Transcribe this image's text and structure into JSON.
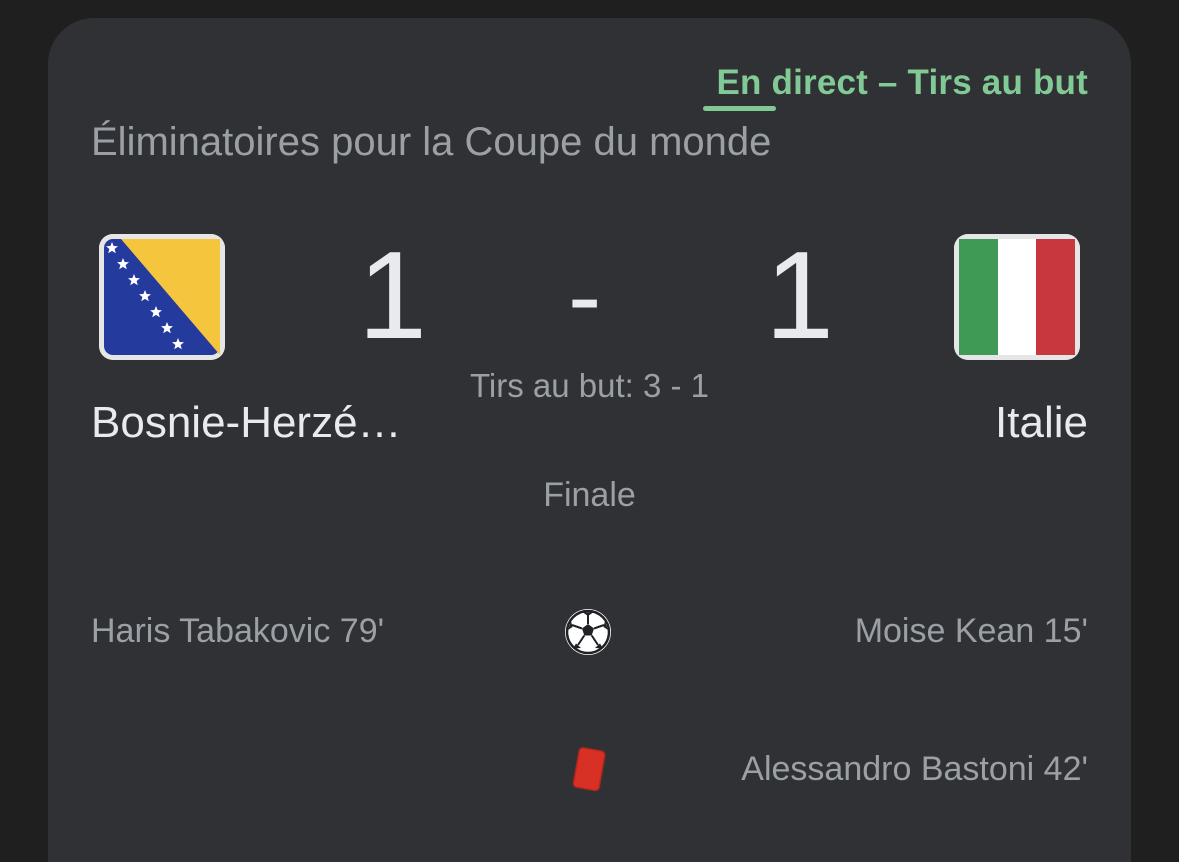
{
  "card": {
    "live_status": "En direct – Tirs au but",
    "competition": "Éliminatoires pour la Coupe du monde"
  },
  "match": {
    "home_team": "Bosnie-Herzé…",
    "away_team": "Italie",
    "home_score": "1",
    "away_score": "1",
    "separator": "-",
    "penalties": "Tirs au but: 3 - 1",
    "status": "Finale"
  },
  "flags": {
    "home": "bosnia-herzegovina-flag",
    "away": "italy-flag"
  },
  "events": [
    {
      "icon": "soccer-ball-icon",
      "home": "Haris Tabakovic 79'",
      "away": "Moise Kean 15'"
    },
    {
      "icon": "red-card-icon",
      "home": "",
      "away": "Alessandro Bastoni 42'"
    }
  ],
  "colors": {
    "accent": "#81c995",
    "card_background": "#303134",
    "page_background": "#1f1f1f",
    "primary_text": "#e8eaed",
    "secondary_text": "#9aa0a6",
    "red_card": "#d93025"
  }
}
